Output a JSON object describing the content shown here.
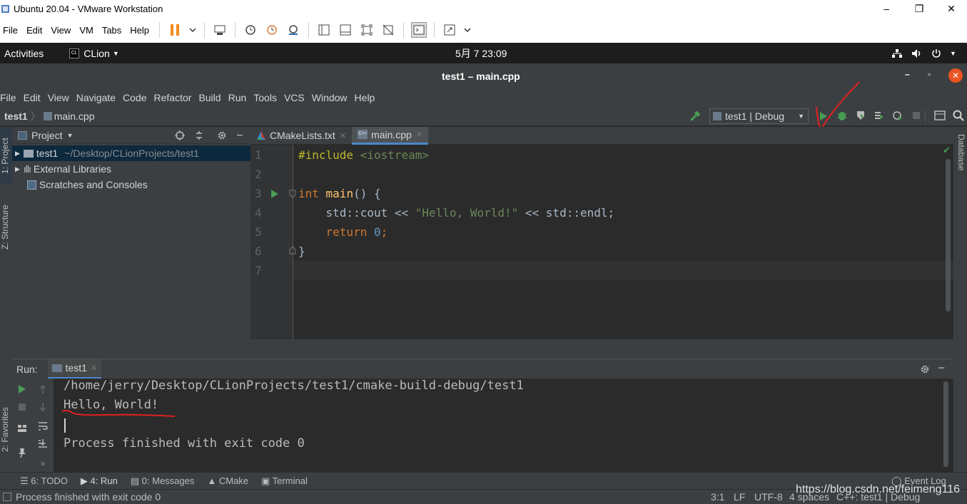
{
  "vm": {
    "title": "Ubuntu 20.04  - VMware Workstation",
    "menus": [
      "File",
      "Edit",
      "View",
      "VM",
      "Tabs",
      "Help"
    ],
    "minimize": "–",
    "restore": "❐",
    "close": "✕"
  },
  "gnome": {
    "activities": "Activities",
    "app": "CLion",
    "clock": "5月 7  23:09"
  },
  "clion": {
    "title": "test1 – main.cpp",
    "menus": [
      "File",
      "Edit",
      "View",
      "Navigate",
      "Code",
      "Refactor",
      "Build",
      "Run",
      "Tools",
      "VCS",
      "Window",
      "Help"
    ],
    "breadcrumb_project": "test1",
    "breadcrumb_file": "main.cpp",
    "run_config": "test1 | Debug"
  },
  "left_strip": {
    "project": "1: Project",
    "structure": "Z: Structure",
    "favorites": "2: Favorites"
  },
  "right_strip": {
    "database": "Database"
  },
  "project_pane": {
    "title": "Project",
    "items": [
      {
        "label": "test1",
        "path": "~/Desktop/CLionProjects/test1"
      },
      {
        "label": "External Libraries"
      },
      {
        "label": "Scratches and Consoles"
      }
    ]
  },
  "editor": {
    "tabs": [
      {
        "label": "CMakeLists.txt"
      },
      {
        "label": "main.cpp"
      }
    ],
    "line_numbers": [
      "1",
      "2",
      "3",
      "4",
      "5",
      "6",
      "7"
    ],
    "code": {
      "l1_kw": "#include",
      "l1_rest": " <iostream>",
      "l3_type": "int",
      "l3_name": " main",
      "l3_rest": "() {",
      "l4_a": "    std::cout << ",
      "l4_str": "\"Hello, World!\"",
      "l4_b": " << std::endl;",
      "l5_kw": "    return",
      "l5_num": " 0",
      "l5_rest": ";",
      "l6": "}"
    }
  },
  "run": {
    "label": "Run:",
    "tab": "test1",
    "output": [
      "/home/jerry/Desktop/CLionProjects/test1/cmake-build-debug/test1",
      "Hello, World!",
      "",
      "Process finished with exit code 0"
    ]
  },
  "tool_tabs": {
    "todo": "6: TODO",
    "run": "4: Run",
    "messages": "0: Messages",
    "cmake": "CMake",
    "terminal": "Terminal",
    "event_log": "Event Log"
  },
  "status": {
    "message": "Process finished with exit code 0",
    "position": "3:1",
    "line_sep": "LF",
    "encoding": "UTF-8",
    "indent": "4 spaces",
    "context": "C++: test1 | Debug"
  },
  "watermark": "https://blog.csdn.net/feimeng116",
  "colors": {
    "accent": "#4a88c7",
    "run_green": "#499c54",
    "annotation_red": "#e02020"
  }
}
